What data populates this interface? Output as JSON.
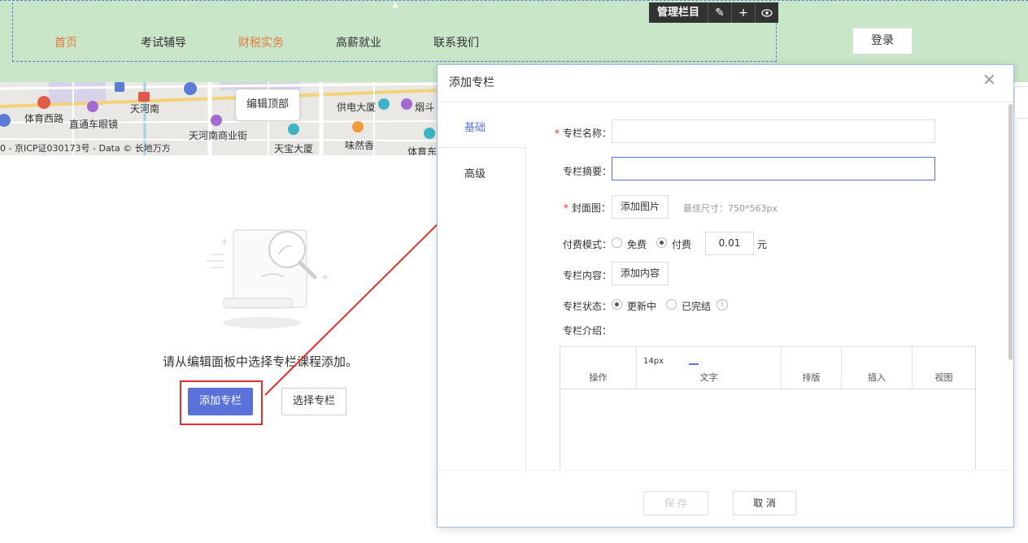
{
  "nav": {
    "items": [
      {
        "label": "首页",
        "active": true
      },
      {
        "label": "考试辅导",
        "active": false
      },
      {
        "label": "财税实务",
        "active": true
      },
      {
        "label": "高薪就业",
        "active": false
      },
      {
        "label": "联系我们",
        "active": false
      }
    ],
    "manage_label": "管理栏目",
    "login_label": "登录"
  },
  "map": {
    "labels": [
      "体育西路",
      "直通车眼镜",
      "天河南",
      "天河南商业街",
      "供电大厦",
      "烟斗",
      "味然香",
      "天宝大厦",
      "体育东"
    ],
    "copyright": "0 - 京ICP证030173号 - Data © 长地万方",
    "edit_top_label": "编辑顶部"
  },
  "empty_state": {
    "message": "请从编辑面板中选择专栏课程添加。",
    "add_button": "添加专栏",
    "select_button": "选择专栏"
  },
  "modal": {
    "title": "添加专栏",
    "tabs": [
      "基础",
      "高级"
    ],
    "fields": {
      "name_label": "专栏名称：",
      "summary_label": "专栏摘要：",
      "cover_label": "封面图：",
      "cover_button": "添加图片",
      "cover_hint": "最佳尺寸：750*563px",
      "pay_label": "付费模式：",
      "pay_options": [
        "免费",
        "付费"
      ],
      "pay_selected": "付费",
      "price_value": "0.01",
      "price_unit": "元",
      "content_label": "专栏内容：",
      "content_button": "添加内容",
      "status_label": "专栏状态：",
      "status_options": [
        "更新中",
        "已完结"
      ],
      "status_selected": "更新中",
      "intro_label": "专栏介绍："
    },
    "editor": {
      "font_size": "14px",
      "groups": [
        "操作",
        "文字",
        "排版",
        "插入",
        "视图"
      ]
    },
    "save_label": "保 存",
    "cancel_label": "取 消"
  },
  "colors": {
    "topbar_bg": "#c9e6c9",
    "accent": "#5a72d9",
    "nav_active": "#e07a3c",
    "annotation_red": "#e2312d"
  }
}
